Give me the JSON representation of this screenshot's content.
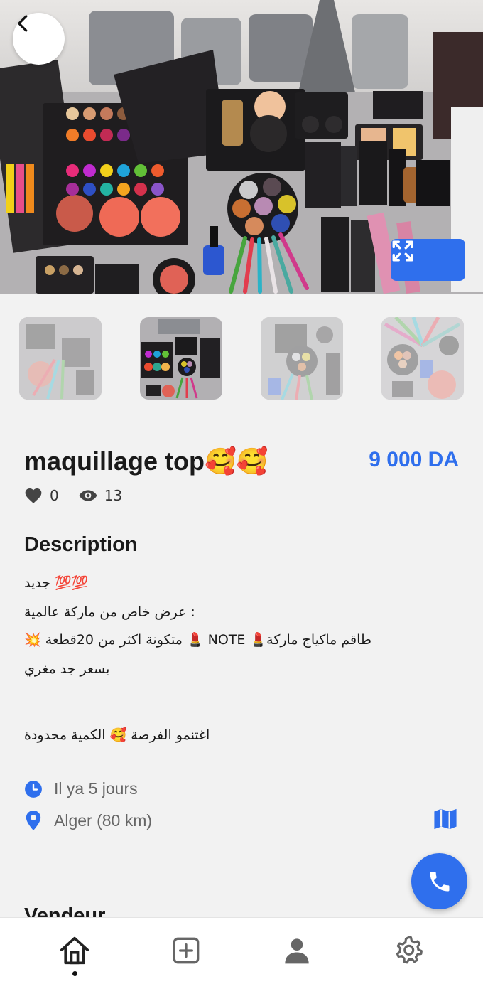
{
  "listing": {
    "title": "maquillage top🥰🥰",
    "price": "9 000 DA",
    "likes": "0",
    "views": "13"
  },
  "description": {
    "heading": "Description",
    "lines": [
      "جديد 💯💯",
      " عرض خاص من ماركة عالمية :",
      "💥 متكونة اكثر من 20قطعة 💄 NOTE 💄طاقم ماكياج ماركة",
      " بسعر جد مغري",
      "اغتنمو الفرصة 🥰 الكمية محدودة"
    ]
  },
  "meta": {
    "posted": "Il ya 5 jours",
    "location": "Alger (80 km)"
  },
  "seller": {
    "heading": "Vendeur"
  },
  "icons": {
    "back": "chevron-left-icon",
    "expand": "expand-icon",
    "like": "heart-icon",
    "views": "eye-icon",
    "time": "clock-icon",
    "location": "map-pin-icon",
    "map": "map-icon",
    "call": "phone-icon",
    "nav": [
      "home-icon",
      "add-square-icon",
      "user-icon",
      "gear-icon"
    ]
  },
  "colors": {
    "accent": "#2f6fed",
    "background": "#f2f2f2",
    "text": "#1a1a1a",
    "muted": "#666666"
  }
}
